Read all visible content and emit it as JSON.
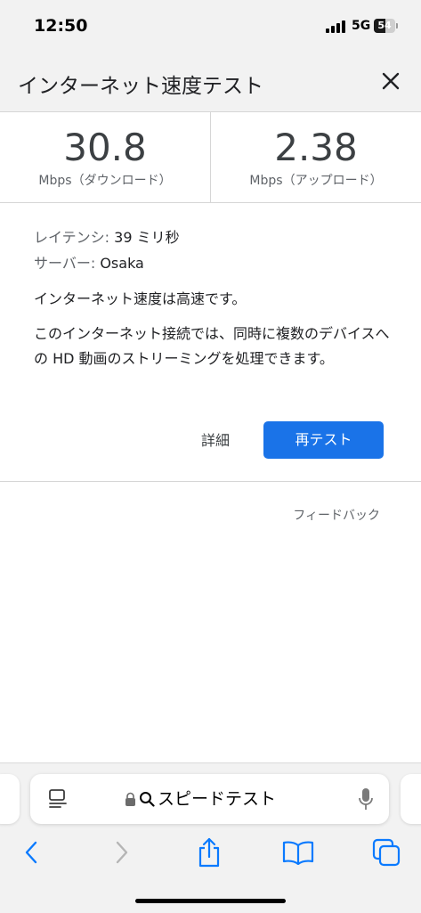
{
  "status_bar": {
    "time": "12:50",
    "network": "5G",
    "battery_level": "54",
    "battery_fraction": 0.54
  },
  "header": {
    "title": "インターネット速度テスト",
    "close_icon": "close-icon"
  },
  "results": {
    "download": {
      "value": "30.8",
      "label": "Mbps（ダウンロード）"
    },
    "upload": {
      "value": "2.38",
      "label": "Mbps（アップロード）"
    }
  },
  "details": {
    "latency_label": "レイテンシ:",
    "latency_value": "39 ミリ秒",
    "server_label": "サーバー:",
    "server_value": "Osaka",
    "summary": "インターネット速度は高速です。",
    "description": "このインターネット接続では、同時に複数のデバイスへの HD 動画のストリーミングを処理できます。"
  },
  "actions": {
    "details_label": "詳細",
    "retest_label": "再テスト",
    "feedback_label": "フィードバック"
  },
  "address_bar": {
    "text": "スピードテスト",
    "icons": [
      "reader-icon",
      "lock-icon",
      "search-icon",
      "mic-icon"
    ]
  },
  "toolbar": {
    "icons": [
      "back-icon",
      "forward-icon",
      "share-icon",
      "bookmarks-icon",
      "tabs-icon"
    ]
  },
  "colors": {
    "accent": "#1a73e8",
    "safari_blue": "#0a7aff",
    "bar_background": "#f2f2f2"
  }
}
